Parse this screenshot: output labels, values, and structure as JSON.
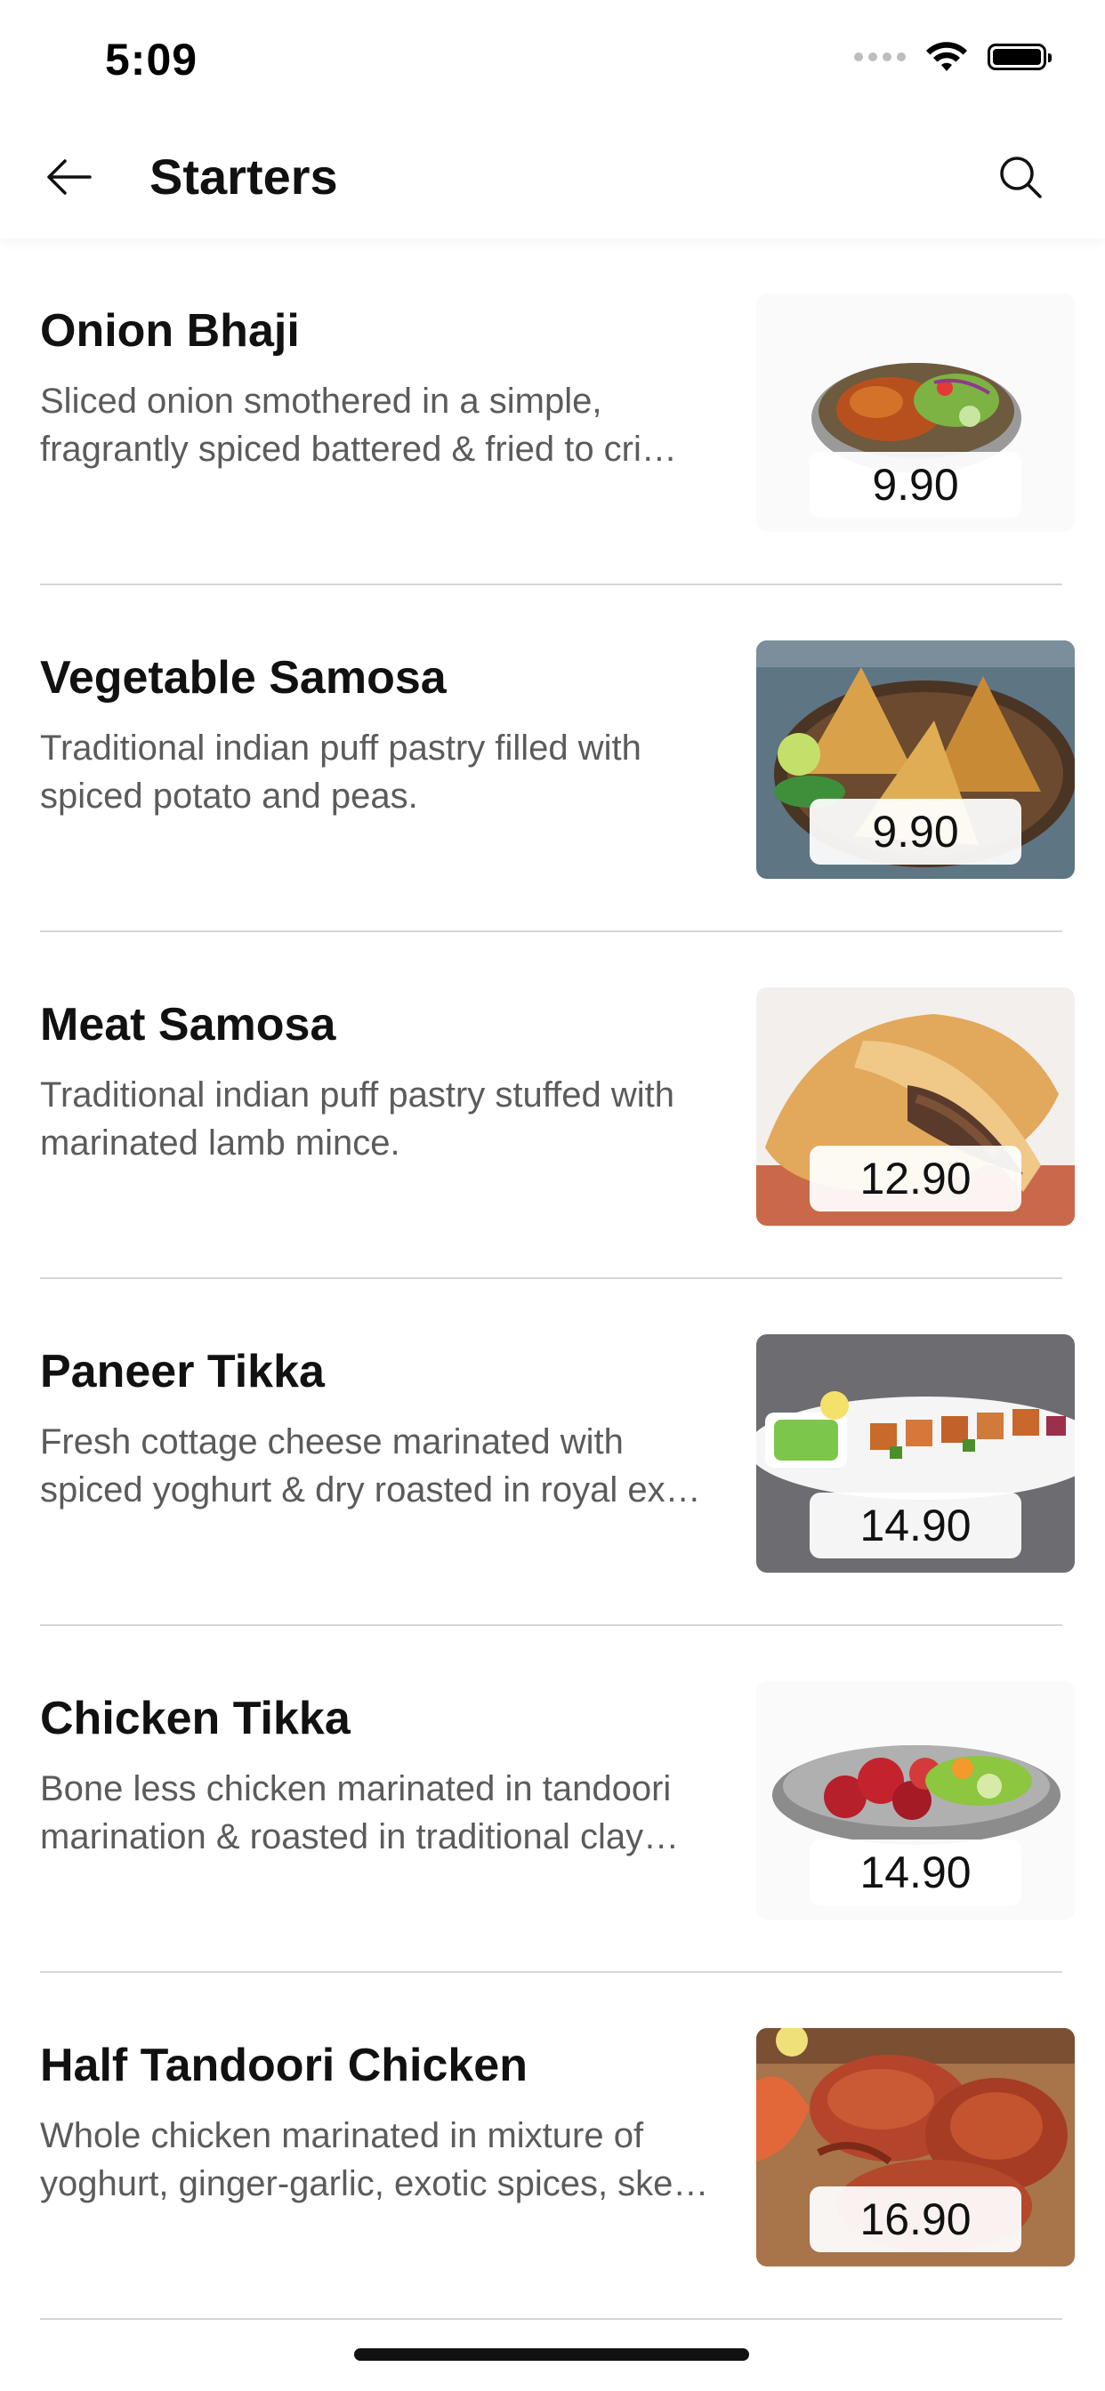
{
  "status_bar": {
    "time": "5:09"
  },
  "header": {
    "title": "Starters",
    "back_icon": "arrow-left-icon",
    "search_icon": "search-icon"
  },
  "items": [
    {
      "name": "Onion Bhaji",
      "description": "Sliced onion smothered in a simple, fragrantly spiced battered & fried to cri…",
      "price": "9.90"
    },
    {
      "name": "Vegetable Samosa",
      "description": "Traditional indian puff pastry filled with spiced potato and peas.",
      "price": "9.90"
    },
    {
      "name": "Meat Samosa",
      "description": "Traditional indian puff pastry stuffed with marinated lamb mince.",
      "price": "12.90"
    },
    {
      "name": "Paneer Tikka",
      "description": "Fresh cottage cheese marinated with spiced yoghurt & dry roasted in royal ex…",
      "price": "14.90"
    },
    {
      "name": "Chicken Tikka",
      "description": "Bone less chicken marinated in tandoori marination & roasted in traditional clay…",
      "price": "14.90"
    },
    {
      "name": "Half Tandoori Chicken",
      "description": "Whole chicken marinated in mixture of yoghurt, ginger-garlic, exotic spices, ske…",
      "price": "16.90"
    }
  ]
}
